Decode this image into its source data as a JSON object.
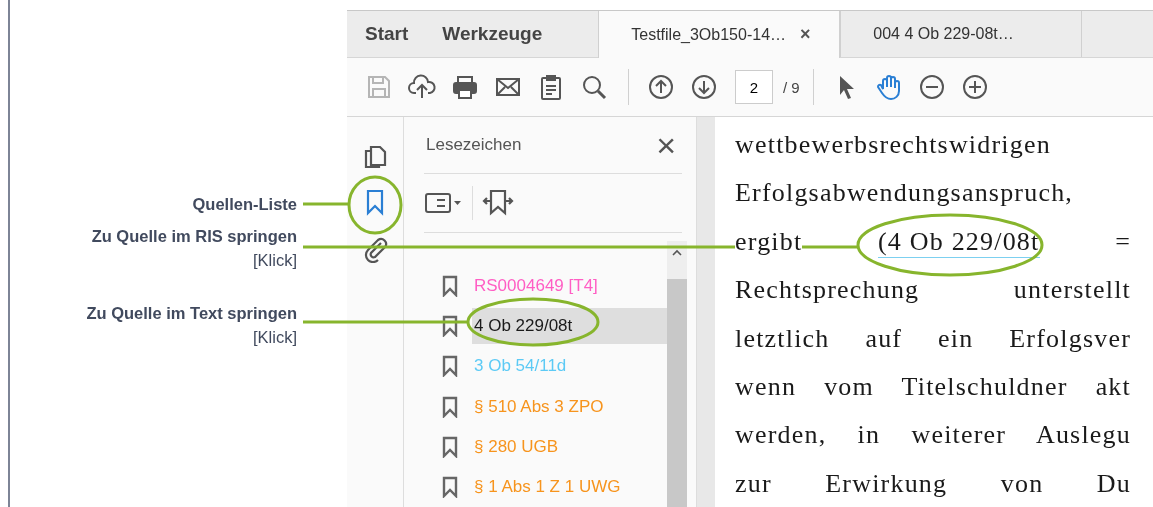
{
  "annotations": [
    {
      "title": "Quellen-Liste"
    },
    {
      "title": "Zu Quelle im RIS springen",
      "note": "[Klick]"
    },
    {
      "title": "Zu Quelle im Text springen",
      "note": "[Klick]"
    }
  ],
  "tabs": [
    {
      "label": "Start",
      "kind": "nav",
      "selected": false
    },
    {
      "label": "Werkzeuge",
      "kind": "nav",
      "selected": false
    },
    {
      "label": "Testfile_3Ob150-14…",
      "kind": "doc",
      "selected": true,
      "close": "×"
    },
    {
      "label": "004  4 Ob 229-08t…",
      "kind": "doc",
      "selected": false
    }
  ],
  "toolbar": {
    "buttons": [
      {
        "kind": "save",
        "disabled": true
      },
      {
        "kind": "upload",
        "disabled": false
      },
      {
        "kind": "print",
        "disabled": false
      },
      {
        "kind": "mail",
        "disabled": false
      },
      {
        "kind": "clipboard",
        "disabled": false
      },
      {
        "kind": "search",
        "disabled": false
      },
      {
        "kind": "up",
        "disabled": false
      },
      {
        "kind": "down",
        "disabled": false
      }
    ],
    "page": "2",
    "page_total": "/ 9",
    "tools": [
      {
        "kind": "pointer",
        "selected": false
      },
      {
        "kind": "hand",
        "selected": true
      }
    ],
    "zoom": [
      {
        "kind": "out"
      },
      {
        "kind": "in"
      }
    ]
  },
  "rail": [
    {
      "kind": "pages",
      "selected": false
    },
    {
      "kind": "bookmarks",
      "selected": true
    },
    {
      "kind": "attachments",
      "selected": false
    }
  ],
  "bookmarks": {
    "title": "Lesezeichen",
    "close": "×",
    "items": [
      {
        "label": "RS0004649 [T4]",
        "color": "#ff5ec4",
        "selected": false
      },
      {
        "label": "4 Ob 229/08t",
        "color": "#1a1a1a",
        "selected": true
      },
      {
        "label": "3 Ob 54/11d",
        "color": "#5ccaf5",
        "selected": false
      },
      {
        "label": "§ 510 Abs 3 ZPO",
        "color": "#f7941d",
        "selected": false
      },
      {
        "label": "§ 280 UGB",
        "color": "#f7941d",
        "selected": false
      },
      {
        "label": "§ 1 Abs 1 Z 1 UWG",
        "color": "#f7941d",
        "selected": false
      }
    ]
  },
  "document": {
    "lines": [
      {
        "kind": "text",
        "text": "wettbewerbsrechtswidrigen"
      },
      {
        "kind": "text",
        "text": "Erfolgsabwendungsanspruch,"
      },
      {
        "kind": "citation",
        "before": "ergibt",
        "link": "(4 Ob 229/08t",
        "after": "="
      },
      {
        "kind": "text",
        "text": "Rechtsprechung unterstellt"
      },
      {
        "kind": "text",
        "text": "letztlich auf ein Erfolgsver"
      },
      {
        "kind": "text",
        "text": "wenn vom Titelschuldner akt"
      },
      {
        "kind": "text",
        "text": "werden, in weiterer Auslegu"
      },
      {
        "kind": "text",
        "text": "zur Erwirkung von Du"
      }
    ]
  }
}
